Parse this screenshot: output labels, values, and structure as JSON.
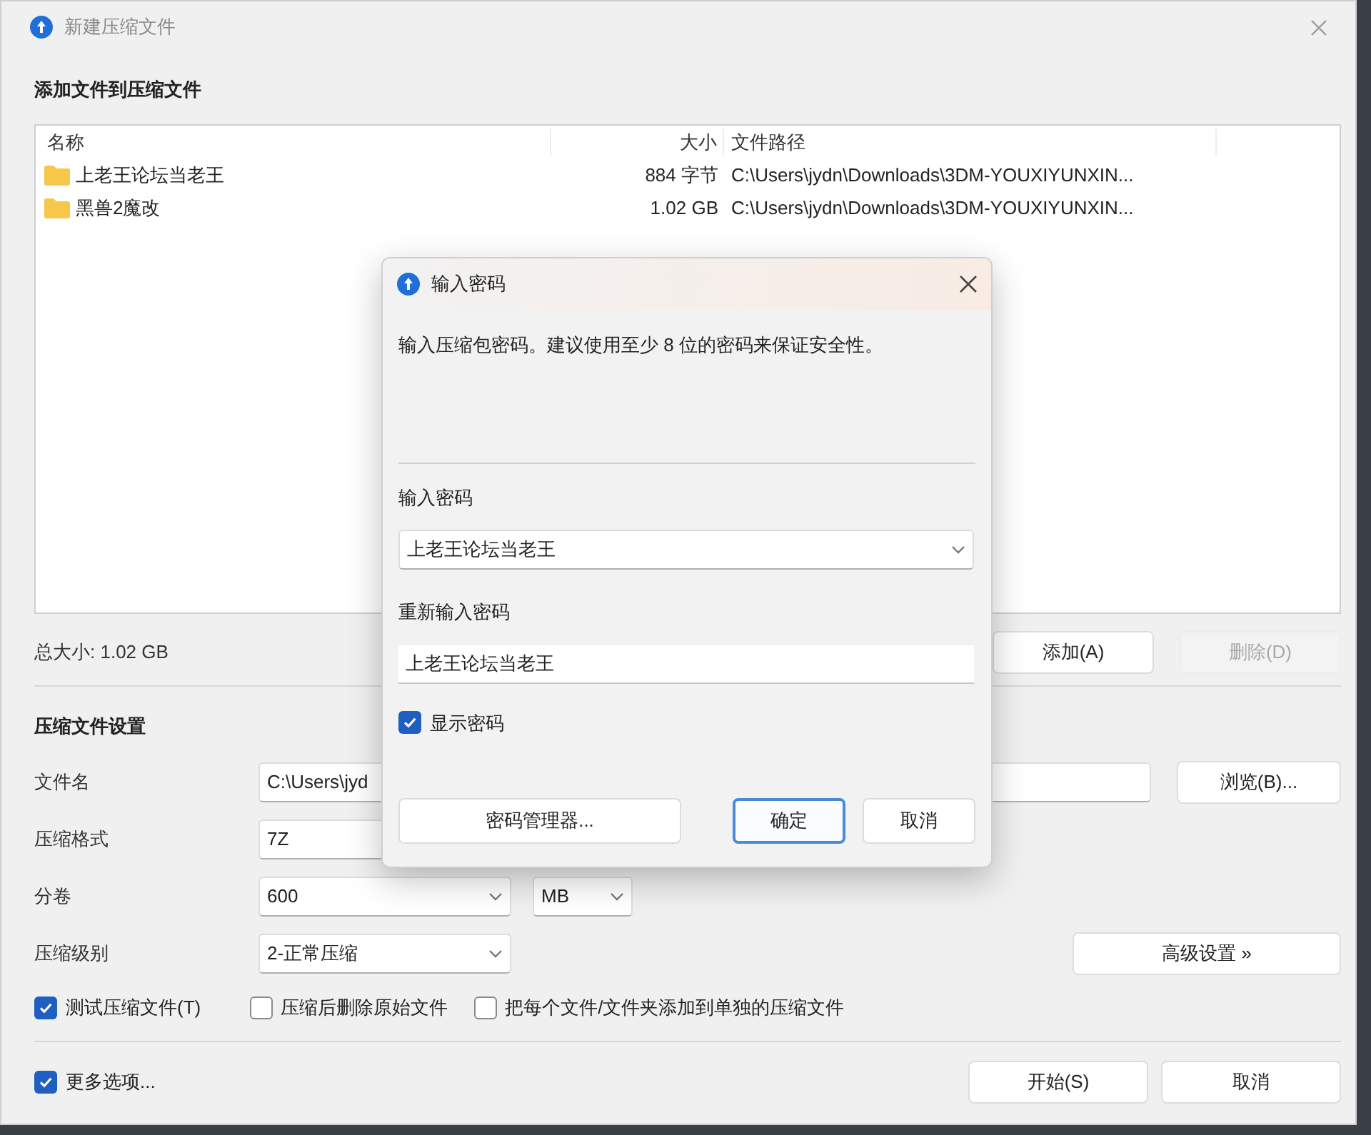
{
  "window": {
    "title": "新建压缩文件"
  },
  "files": {
    "heading": "添加文件到压缩文件",
    "columns": [
      "名称",
      "大小",
      "文件路径"
    ],
    "rows": [
      {
        "name": "上老王论坛当老王",
        "size": "884 字节",
        "path": "C:\\Users\\jydn\\Downloads\\3DM-YOUXIYUNXIN..."
      },
      {
        "name": "黑兽2魔改",
        "size": "1.02 GB",
        "path": "C:\\Users\\jydn\\Downloads\\3DM-YOUXIYUNXIN..."
      }
    ]
  },
  "total_size": "总大小: 1.02 GB",
  "list_buttons": [
    {
      "label": "添加(A)",
      "disabled": false
    },
    {
      "label": "删除(D)",
      "disabled": true
    }
  ],
  "settings": {
    "heading": "压缩文件设置",
    "filename": {
      "label": "文件名",
      "value": "C:\\Users\\jyd"
    },
    "browse_button": "浏览(B)...",
    "format": {
      "label": "压缩格式",
      "value": "7Z"
    },
    "split": {
      "label": "分卷",
      "value": "600",
      "unit": "MB"
    },
    "level": {
      "label": "压缩级别",
      "value": "2-正常压缩"
    },
    "advanced_button": "高级设置 »"
  },
  "options": [
    {
      "label": "测试压缩文件(T)",
      "checked": true
    },
    {
      "label": "压缩后删除原始文件",
      "checked": false
    },
    {
      "label": "把每个文件/文件夹添加到单独的压缩文件",
      "checked": false
    }
  ],
  "more_options": {
    "label": "更多选项...",
    "checked": true
  },
  "footer_buttons": [
    "开始(S)",
    "取消"
  ],
  "dialog": {
    "title": "输入密码",
    "message": "输入压缩包密码。建议使用至少 8 位的密码来保证安全性。",
    "password_label": "输入密码",
    "password": "上老王论坛当老王",
    "reenter_label": "重新输入密码",
    "reenter": "上老王论坛当老王",
    "show_password": {
      "label": "显示密码",
      "checked": true
    },
    "manager_button": "密码管理器...",
    "buttons": [
      {
        "label": "确定",
        "focused": true
      },
      {
        "label": "取消",
        "focused": false
      }
    ]
  }
}
